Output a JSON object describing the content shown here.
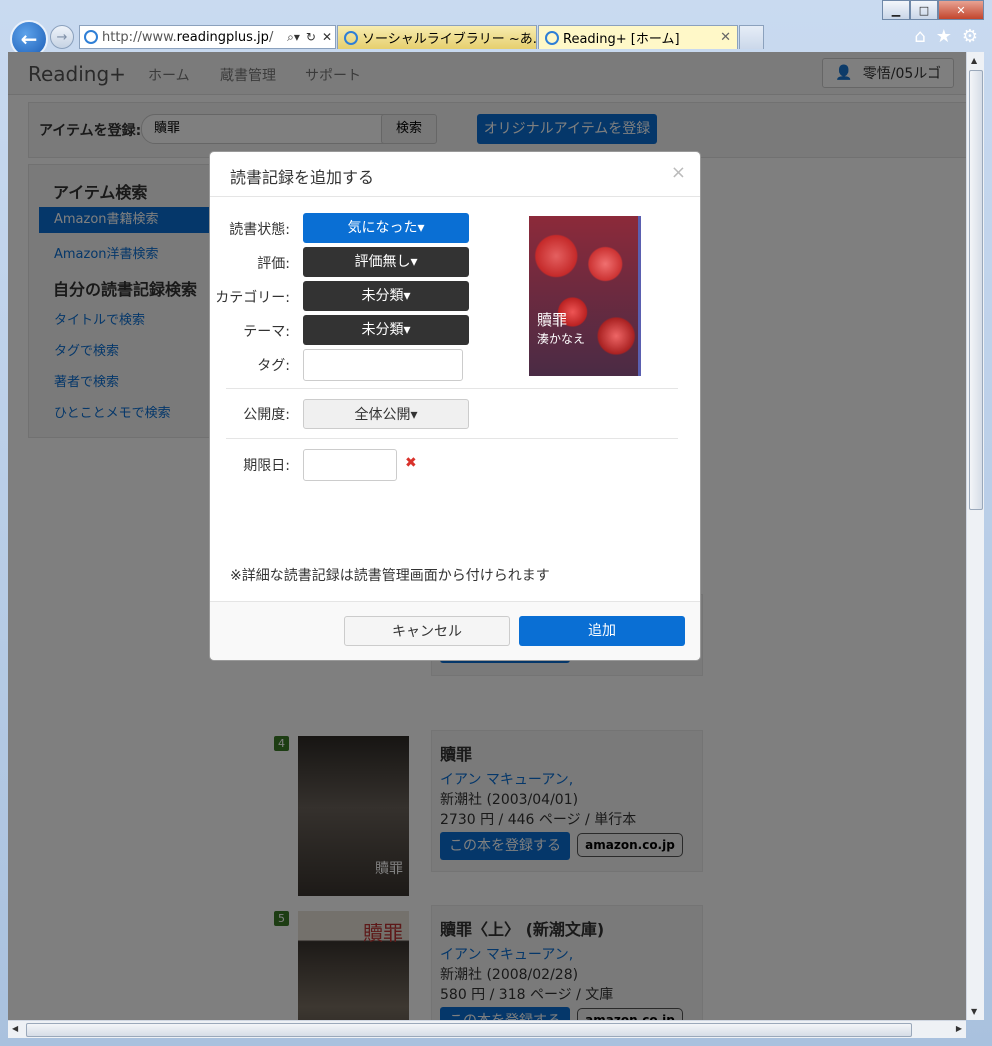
{
  "browser": {
    "address_prefix": "http://www.",
    "address_host": "readingplus.jp",
    "address_suffix": "/",
    "tabs": [
      {
        "label": "ソーシャルライブラリー ~あ..."
      },
      {
        "label": "Reading+ [ホーム]"
      }
    ]
  },
  "navbar": {
    "brand": "Reading+",
    "links": [
      "ホーム",
      "蔵書管理",
      "サポート"
    ],
    "user": "零悟/05ルゴ"
  },
  "register": {
    "label": "アイテムを登録:",
    "query": "贖罪",
    "search_button": "検索",
    "original_button": "オリジナルアイテムを登録"
  },
  "sidebar": {
    "heading_items": "アイテム検索",
    "items": [
      "Amazon書籍検索",
      "Amazon洋書検索"
    ],
    "heading_records": "自分の読書記録検索",
    "record_links": [
      "タイトルで検索",
      "タグで検索",
      "著者で検索",
      "ひとことメモで検索"
    ]
  },
  "results": [
    {
      "num": "4",
      "title": "贖罪",
      "author": "イアン マキューアン,",
      "publisher": "新潮社 (2003/04/01)",
      "price": "2730 円 / 446 ページ / 単行本",
      "cover_text": "贖罪"
    },
    {
      "num": "5",
      "title": "贖罪〈上〉 (新潮文庫)",
      "author": "イアン マキューアン,",
      "publisher": "新潮社 (2008/02/28)",
      "price": "580 円 / 318 ページ / 文庫",
      "cover_text": "贖罪"
    }
  ],
  "result_buttons": {
    "register": "この本を登録する",
    "amazon": "amazon.co.jp"
  },
  "modal": {
    "title": "読書記録を追加する",
    "close": "×",
    "labels": {
      "status": "読書状態:",
      "rating": "評価:",
      "category": "カテゴリー:",
      "theme": "テーマ:",
      "tag": "タグ:",
      "visibility": "公開度:",
      "due": "期限日:"
    },
    "values": {
      "status": "気になった▾",
      "rating": "評価無し▾",
      "category": "未分類▾",
      "theme": "未分類▾",
      "tag": "",
      "visibility": "全体公開▾",
      "due": ""
    },
    "book": {
      "title": "贖罪",
      "author": "湊かなえ"
    },
    "note": "※詳細な読書記録は読書管理画面から付けられます",
    "cancel": "キャンセル",
    "add": "追加"
  }
}
